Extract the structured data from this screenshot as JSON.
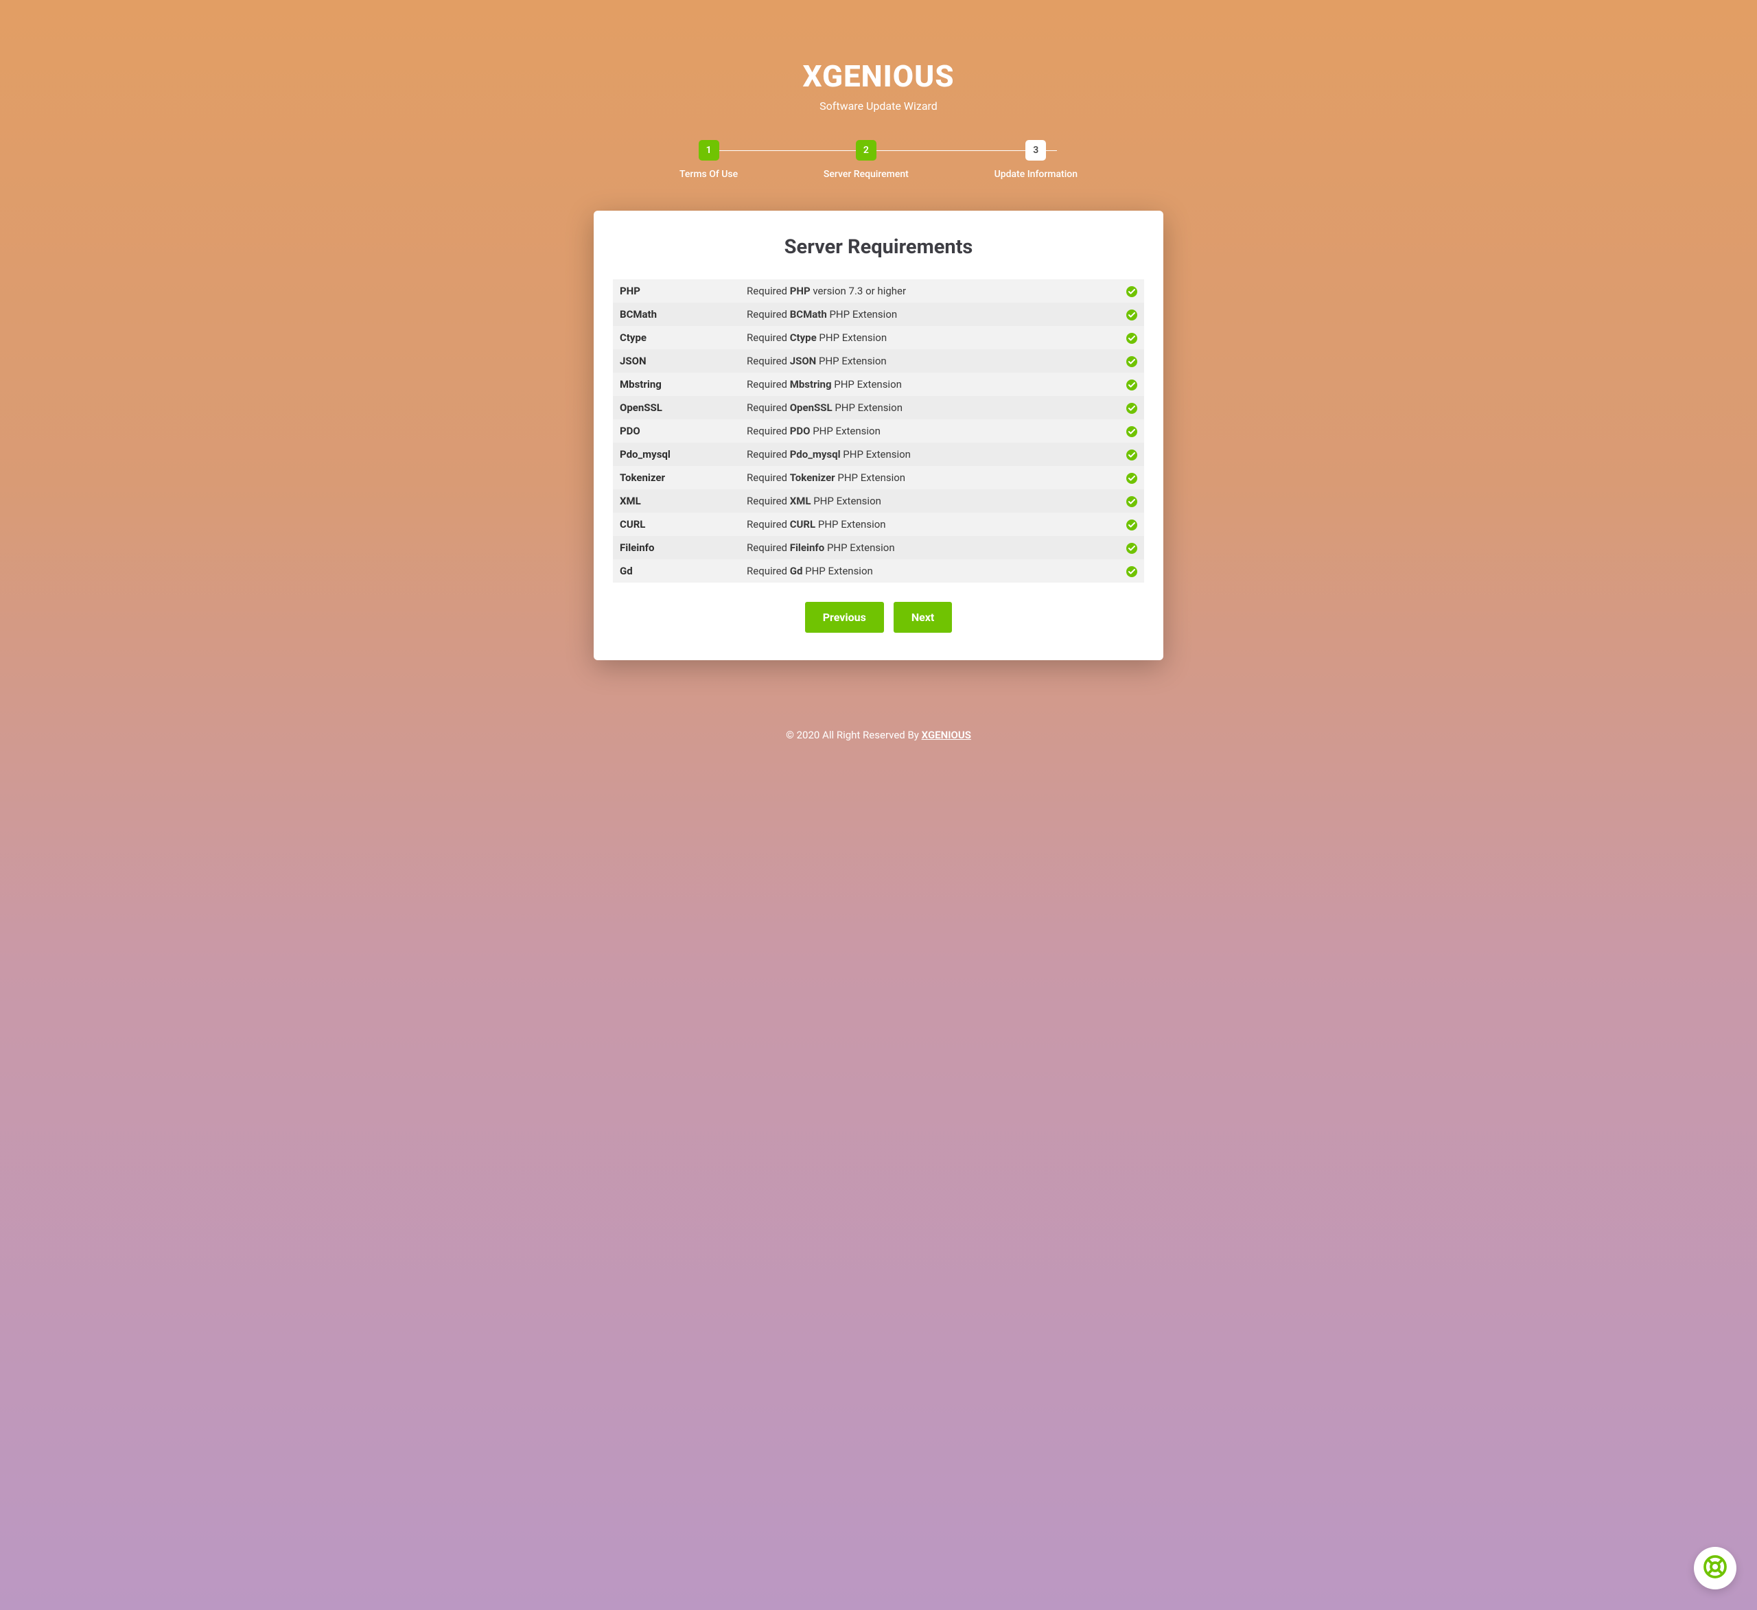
{
  "header": {
    "brand": "XGENIOUS",
    "subtitle": "Software Update Wizard"
  },
  "stepper": {
    "steps": [
      {
        "number": "1",
        "label": "Terms Of Use",
        "state": "completed"
      },
      {
        "number": "2",
        "label": "Server Requirement",
        "state": "active"
      },
      {
        "number": "3",
        "label": "Update Information",
        "state": "pending"
      }
    ]
  },
  "card": {
    "title": "Server Requirements"
  },
  "requirements": [
    {
      "name": "PHP",
      "desc_prefix": "Required ",
      "desc_bold": "PHP",
      "desc_suffix": " version 7.3 or higher",
      "ok": true
    },
    {
      "name": "BCMath",
      "desc_prefix": "Required ",
      "desc_bold": "BCMath",
      "desc_suffix": " PHP Extension",
      "ok": true
    },
    {
      "name": "Ctype",
      "desc_prefix": "Required ",
      "desc_bold": "Ctype",
      "desc_suffix": " PHP Extension",
      "ok": true
    },
    {
      "name": "JSON",
      "desc_prefix": "Required ",
      "desc_bold": "JSON",
      "desc_suffix": " PHP Extension",
      "ok": true
    },
    {
      "name": "Mbstring",
      "desc_prefix": "Required ",
      "desc_bold": "Mbstring",
      "desc_suffix": " PHP Extension",
      "ok": true
    },
    {
      "name": "OpenSSL",
      "desc_prefix": "Required ",
      "desc_bold": "OpenSSL",
      "desc_suffix": " PHP Extension",
      "ok": true
    },
    {
      "name": "PDO",
      "desc_prefix": "Required ",
      "desc_bold": "PDO",
      "desc_suffix": " PHP Extension",
      "ok": true
    },
    {
      "name": "Pdo_mysql",
      "desc_prefix": "Required ",
      "desc_bold": "Pdo_mysql",
      "desc_suffix": " PHP Extension",
      "ok": true
    },
    {
      "name": "Tokenizer",
      "desc_prefix": "Required ",
      "desc_bold": "Tokenizer",
      "desc_suffix": " PHP Extension",
      "ok": true
    },
    {
      "name": "XML",
      "desc_prefix": "Required ",
      "desc_bold": "XML",
      "desc_suffix": " PHP Extension",
      "ok": true
    },
    {
      "name": "CURL",
      "desc_prefix": "Required ",
      "desc_bold": "CURL",
      "desc_suffix": " PHP Extension",
      "ok": true
    },
    {
      "name": "Fileinfo",
      "desc_prefix": "Required ",
      "desc_bold": "Fileinfo",
      "desc_suffix": " PHP Extension",
      "ok": true
    },
    {
      "name": "Gd",
      "desc_prefix": "Required ",
      "desc_bold": "Gd",
      "desc_suffix": " PHP Extension",
      "ok": true
    }
  ],
  "buttons": {
    "previous": "Previous",
    "next": "Next"
  },
  "footer": {
    "text": "© 2020 All Right Reserved By ",
    "link": "XGENIOUS"
  }
}
